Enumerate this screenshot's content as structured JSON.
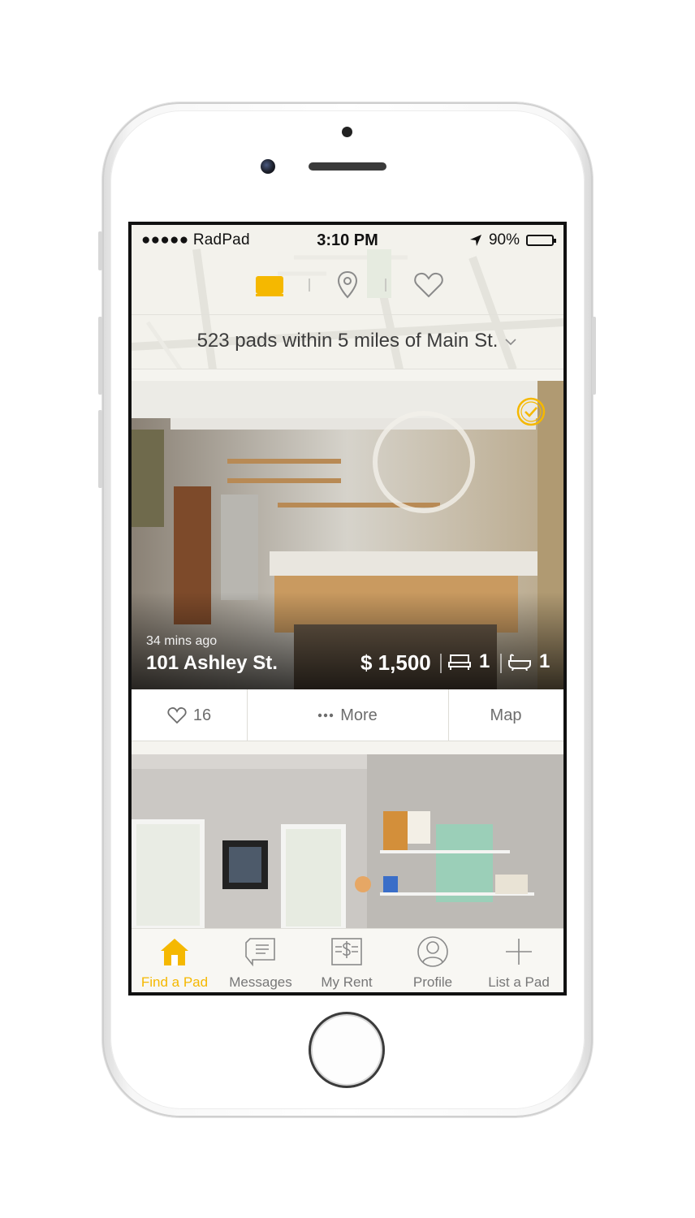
{
  "status_bar": {
    "carrier": "●●●●● RadPad",
    "time": "3:10 PM",
    "battery": "90%"
  },
  "top_nav": {
    "items": [
      {
        "icon": "list-view-icon",
        "active": true
      },
      {
        "icon": "map-pin-icon",
        "active": false
      },
      {
        "icon": "heart-icon",
        "active": false
      }
    ]
  },
  "filter": {
    "summary": "523 pads within 5 miles of Main St."
  },
  "listings": [
    {
      "posted": "34 mins ago",
      "address": "101 Ashley St.",
      "price": "$ 1,500",
      "beds": "1",
      "baths": "1",
      "verified": true,
      "likes": "16",
      "more_label": "More",
      "map_label": "Map"
    }
  ],
  "tabbar": {
    "tabs": [
      {
        "label": "Find a Pad",
        "icon": "house-icon",
        "active": true
      },
      {
        "label": "Messages",
        "icon": "message-bubble-icon",
        "active": false
      },
      {
        "label": "My Rent",
        "icon": "rent-bill-icon",
        "active": false
      },
      {
        "label": "Profile",
        "icon": "profile-icon",
        "active": false
      },
      {
        "label": "List a Pad",
        "icon": "plus-icon",
        "active": false
      }
    ]
  },
  "colors": {
    "accent": "#f5b800",
    "inactive": "#777777",
    "background": "#f5f4ef"
  }
}
